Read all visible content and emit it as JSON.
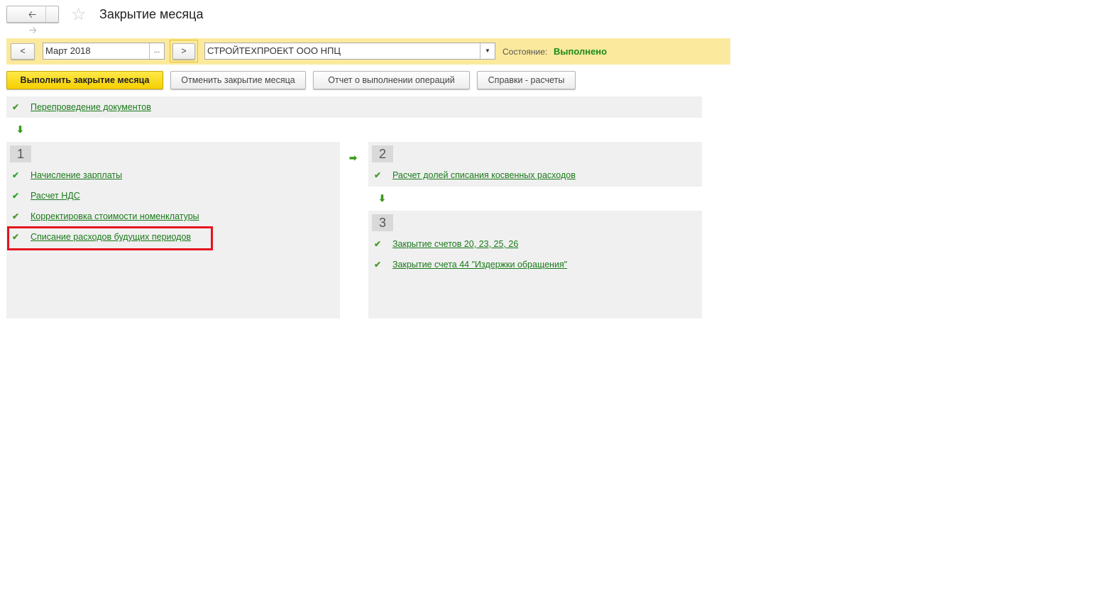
{
  "header": {
    "title": "Закрытие месяца"
  },
  "toolbar": {
    "prev": "<",
    "period": "Март 2018",
    "ellipsis": "...",
    "next": ">",
    "organization": "СТРОЙТЕХПРОЕКТ ООО НПЦ",
    "state_label": "Состояние:",
    "state_value": "Выполнено"
  },
  "actions": {
    "execute": "Выполнить закрытие месяца",
    "cancel": "Отменить закрытие месяца",
    "report": "Отчет о выполнении операций",
    "refs": "Справки - расчеты"
  },
  "pre": {
    "label": "Перепроведение документов"
  },
  "group1": {
    "num": "1",
    "items": [
      "Начисление зарплаты",
      "Расчет НДС",
      "Корректировка стоимости номенклатуры",
      "Списание расходов будущих периодов"
    ]
  },
  "group2": {
    "num": "2",
    "items": [
      "Расчет долей списания косвенных расходов"
    ]
  },
  "group3": {
    "num": "3",
    "items": [
      "Закрытие счетов 20, 23, 25, 26",
      "Закрытие счета 44 \"Издержки обращения\""
    ]
  }
}
